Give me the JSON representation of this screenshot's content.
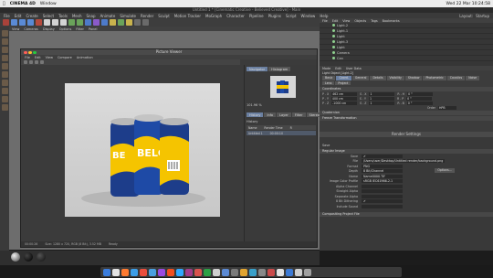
{
  "mac_menu": {
    "apple": "",
    "app": "CINEMA 4D",
    "window": "Window",
    "clock": "Wed 22 Mar  10:24:58"
  },
  "c4d": {
    "title": "Untitled 1 * [Cinematic Creative - Believed Creative] - Main",
    "menu": [
      "File",
      "Edit",
      "Create",
      "Select",
      "Tools",
      "Mesh",
      "Snap",
      "Animate",
      "Simulate",
      "Render",
      "Sculpt",
      "Motion Tracker",
      "MoGraph",
      "Character",
      "Pipeline",
      "Plugins",
      "Script",
      "Window",
      "Help"
    ],
    "layout_label": "Layout:",
    "layout_value": "Startup",
    "toolbar_colors": [
      "#a8423a",
      "#5a8ad4",
      "#5a8ad4",
      "#5a8ad4",
      "#b54a3d",
      "#d4d4d4",
      "#d4d4d4",
      "#d4d4d4",
      "#6aa35a",
      "#6aa35a",
      "#4d7ac9",
      "#8a5ac9",
      "#4d7ac9",
      "#c9b34d",
      "#6aa35a",
      "#c9b34d",
      "#6a6a6a",
      "#6a6a6a"
    ],
    "viewport_menu": [
      "View",
      "Cameras",
      "Display",
      "Options",
      "Filter",
      "Panel"
    ]
  },
  "picture_viewer": {
    "title": "Picture Viewer",
    "menu": [
      "File",
      "Edit",
      "View",
      "Compare",
      "Animation"
    ],
    "tabs": [
      "Navigator",
      "Histogram"
    ],
    "zoom": "101.96 %",
    "subtabs": [
      "History",
      "Info",
      "Layer",
      "Filter",
      "Stereo"
    ],
    "history_header": "History",
    "history_cols": [
      "Name",
      "Render Time",
      "R"
    ],
    "history_row": {
      "name": "Untitled 1",
      "time": "00:00:10"
    },
    "status": {
      "time": "00:00:26",
      "frame": "Size: 1280 x 720, RGB (8 Bit), 3.52 MB",
      "ready": "Ready"
    },
    "can_text": "BELCH!"
  },
  "object_manager": {
    "menu": [
      "File",
      "Edit",
      "View",
      "Objects",
      "Tags",
      "Bookmarks"
    ],
    "objects": [
      "Light.2",
      "Light.1",
      "Light",
      "Light.3",
      "Light",
      "Camera",
      "Can"
    ]
  },
  "attributes": {
    "menu": [
      "Mode",
      "Edit",
      "User Data"
    ],
    "object_title": "Light Object [Light.2]",
    "tabs": [
      "Basic",
      "Coord.",
      "General",
      "Details",
      "Visibility",
      "Shadow",
      "Photometric",
      "Caustics",
      "Noise",
      "Lens",
      "Project"
    ],
    "coords_header": "Coordinates",
    "rows": [
      {
        "a": "P . X",
        "av": "462 cm",
        "b": "S . X",
        "bv": "1",
        "c": "R . H",
        "cv": "0 °"
      },
      {
        "a": "P . Y",
        "av": "400 cm",
        "b": "S . Y",
        "bv": "1",
        "c": "R . P",
        "cv": "0 °"
      },
      {
        "a": "P . Z",
        "av": "-1000 cm",
        "b": "S . Z",
        "bv": "1",
        "c": "R . B",
        "cv": "0 °"
      }
    ],
    "order_label": "Order",
    "order_value": "HPB",
    "sections": [
      "Quaternion",
      "Freeze Transformation"
    ]
  },
  "render_settings": {
    "title": "Render Settings",
    "left_label": "Save",
    "section": "Regular Image",
    "rows": [
      {
        "label": "Save",
        "value": "✔"
      },
      {
        "label": "File",
        "value": "/Users/user/Desktop/Untitled render/background.png"
      },
      {
        "label": "Format",
        "value": "PNG"
      },
      {
        "label": "Depth",
        "value": "8 Bit/Channel"
      },
      {
        "label": "Name",
        "value": "Name0000.TIF"
      },
      {
        "label": "Image Color Profile",
        "value": "sRGB IEC61966-2.1"
      },
      {
        "label": "Alpha Channel",
        "value": ""
      },
      {
        "label": "Straight Alpha",
        "value": ""
      },
      {
        "label": "Separate Alpha",
        "value": ""
      },
      {
        "label": "8 Bit Dithering",
        "value": "✔"
      },
      {
        "label": "Include Sound",
        "value": ""
      }
    ],
    "options_label": "Options...",
    "compositing": "Compositing Project File"
  },
  "dock_colors": [
    "#3b7ddd",
    "#e3e3e3",
    "#ff7b31",
    "#3d9ee7",
    "#ea4e3d",
    "#4aa0e0",
    "#9a4ae0",
    "#f24e1e",
    "#31a8ff",
    "#a33c8c",
    "#d9534f",
    "#2c9f45",
    "#cfcfcf",
    "#5c8ad4",
    "#7a7a7a",
    "#e1a431",
    "#3aa0c9",
    "#888888",
    "#c94a4a",
    "#e3e3e3",
    "#3d7ad4",
    "#cfcfcf",
    "#a0a0a0"
  ]
}
